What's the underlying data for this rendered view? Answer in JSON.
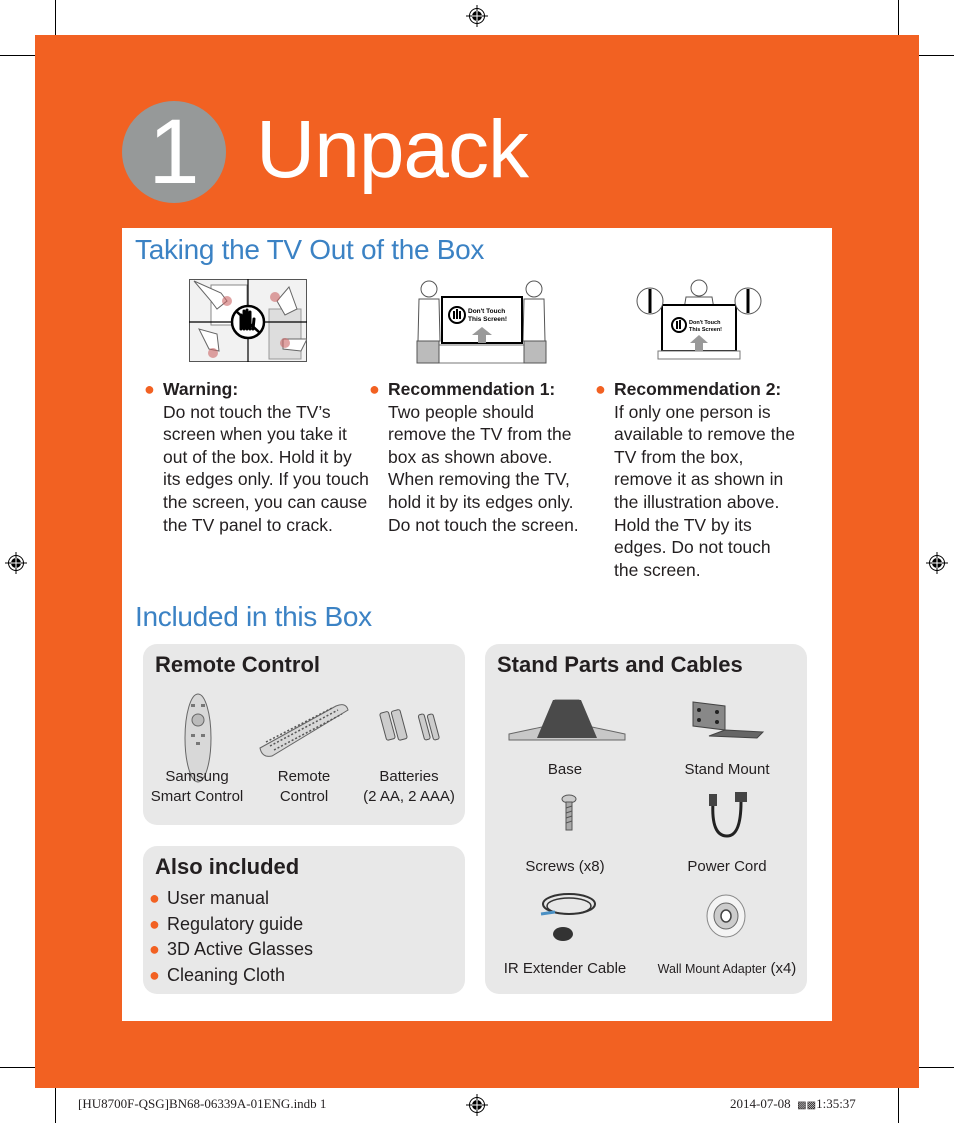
{
  "header": {
    "step_number": "1",
    "title": "Unpack"
  },
  "taking_out": {
    "title": "Taking the TV Out of the Box",
    "illustration_text": "Don't Touch This Screen!",
    "columns": [
      {
        "heading": "Warning:",
        "body": "Do not touch the TV’s screen when you take it out of the box. Hold it by its edges only. If you touch the screen, you can cause the TV panel to crack."
      },
      {
        "heading": "Recommendation 1:",
        "body": "Two people should remove the TV from the box as shown above. When removing the TV, hold it by its edges only. Do not touch the screen."
      },
      {
        "heading": "Recommendation 2:",
        "body": "If only one person is available to remove the TV from the box, remove it as shown in the illustration above. Hold the TV by its edges. Do not touch the screen."
      }
    ]
  },
  "included": {
    "title": "Included in this Box",
    "remote_control": {
      "title": "Remote Control",
      "items": [
        {
          "line1": "Samsung",
          "line2": "Smart Control",
          "icon": "smart-control-icon"
        },
        {
          "line1": "Remote",
          "line2": "Control",
          "icon": "remote-control-icon"
        },
        {
          "line1": "Batteries",
          "line2": "(2 AA, 2 AAA)",
          "icon": "batteries-icon"
        }
      ]
    },
    "also_included": {
      "title": "Also included",
      "items": [
        "User manual",
        "Regulatory guide",
        "3D Active Glasses",
        "Cleaning Cloth"
      ]
    },
    "stand_parts": {
      "title": "Stand Parts and Cables",
      "items": [
        {
          "label": "Base",
          "icon": "stand-base-icon"
        },
        {
          "label": "Stand Mount",
          "icon": "stand-mount-icon"
        },
        {
          "label": "Screws (x8)",
          "icon": "screw-icon"
        },
        {
          "label": "Power Cord",
          "icon": "power-cord-icon"
        },
        {
          "label": "IR Extender Cable",
          "icon": "ir-extender-cable-icon"
        },
        {
          "label": "Wall Mount Adapter",
          "suffix": "(x4)",
          "icon": "wall-mount-adapter-icon"
        }
      ]
    }
  },
  "footer": {
    "file_info": "[HU8700F-QSG]BN68-06339A-01ENG.indb   1",
    "date": "2014-07-08",
    "time_marker": "▩▩",
    "time": "1:35:37"
  },
  "colors": {
    "accent_orange": "#f26122",
    "heading_blue": "#3b82c4",
    "badge_gray": "#969999",
    "box_gray": "#e8e8e8"
  }
}
